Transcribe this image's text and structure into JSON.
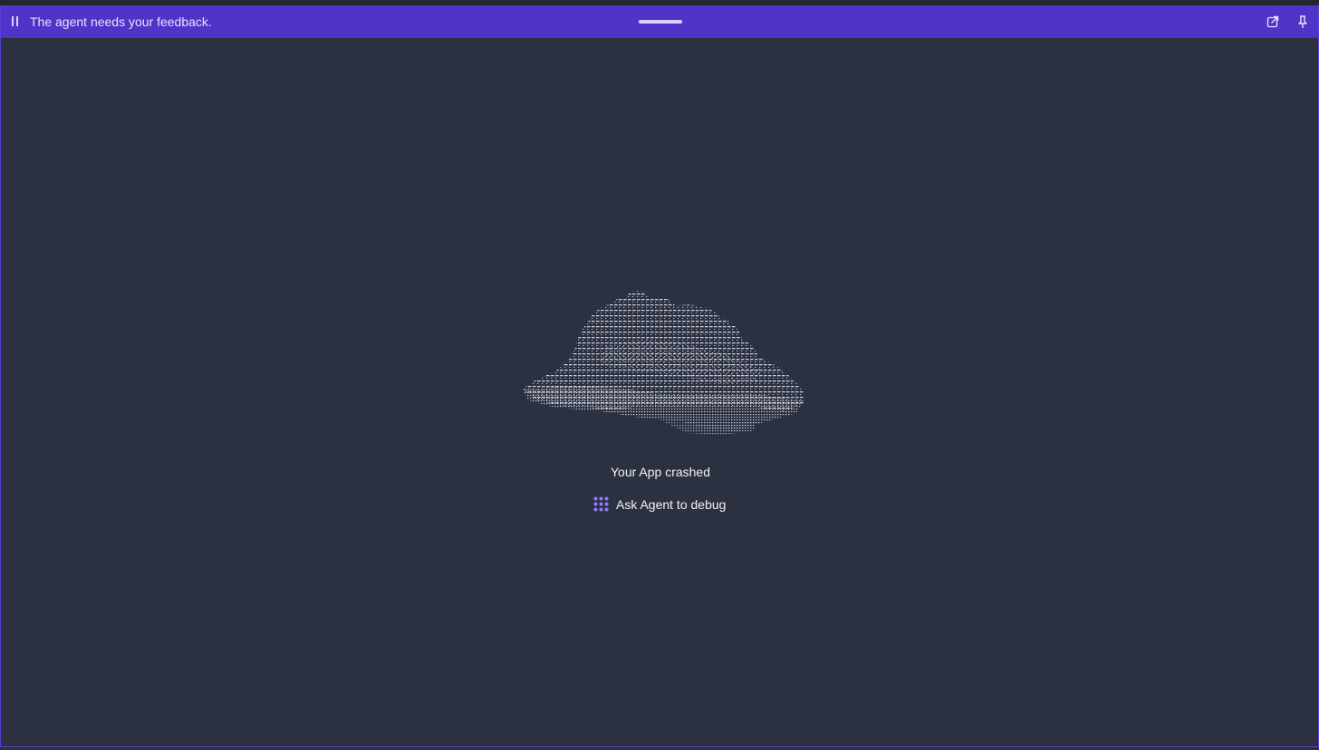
{
  "colors": {
    "titlebar_bg": "#5034c8",
    "window_bg": "#2c3142",
    "accent": "#7b6cf6",
    "text": "#f2f2f5"
  },
  "titlebar": {
    "message": "The agent needs your feedback.",
    "icons": [
      "pause-icon",
      "drag-handle",
      "open-in-new-icon",
      "pin-icon"
    ]
  },
  "main": {
    "crash_message": "Your App crashed",
    "debug_button_label": "Ask Agent to debug",
    "debug_button_icon": "agent-icon"
  }
}
